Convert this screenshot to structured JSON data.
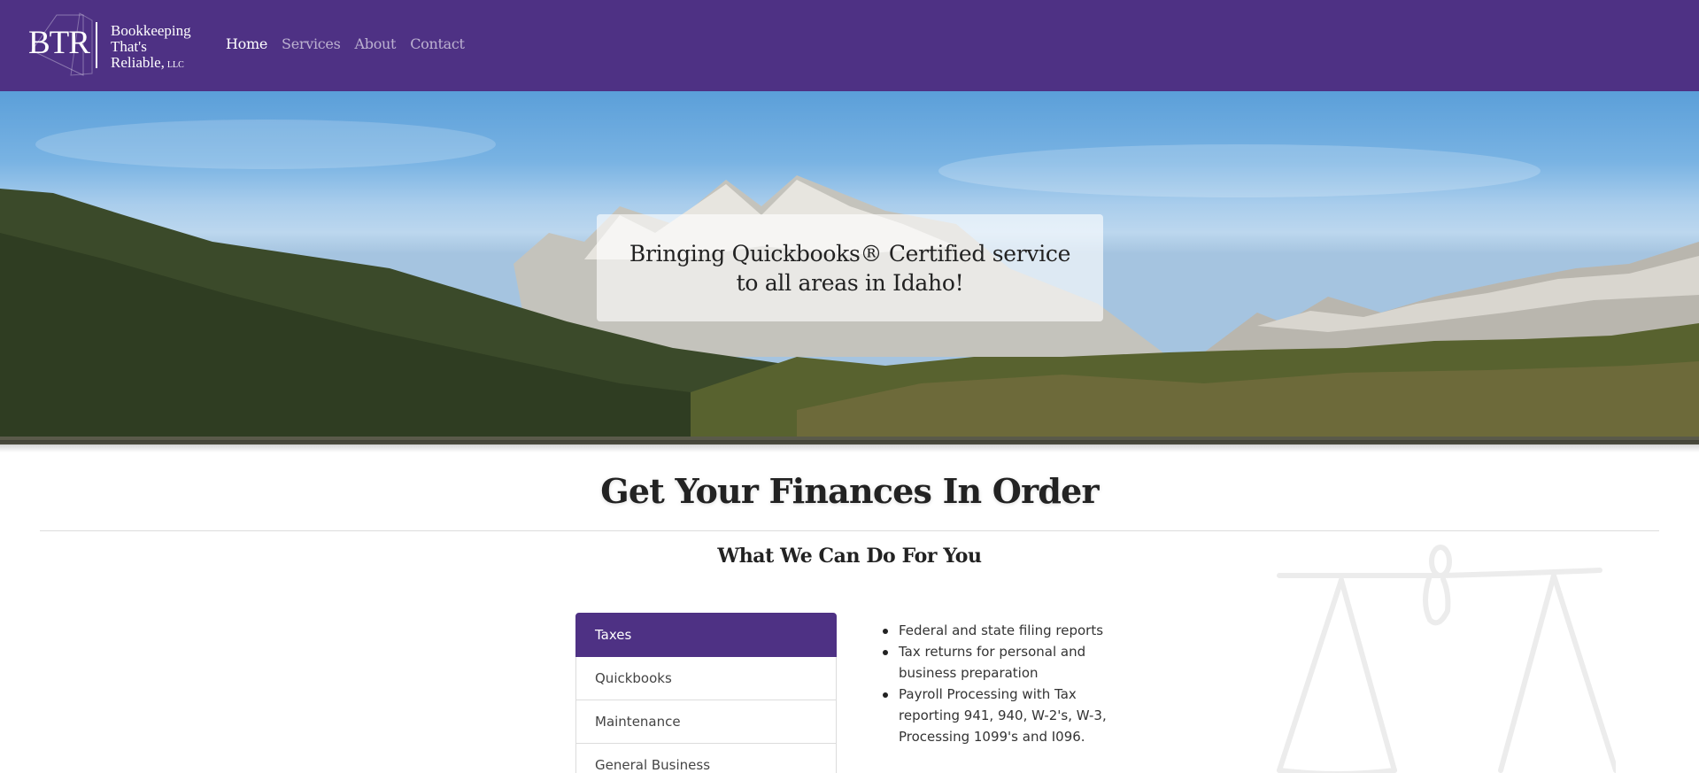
{
  "brand": {
    "initials": "BTR",
    "line1": "Bookkeeping",
    "line2": "That's",
    "line3": "Reliable,",
    "suffix": "LLC"
  },
  "nav": {
    "items": [
      {
        "label": "Home",
        "active": true
      },
      {
        "label": "Services"
      },
      {
        "label": "About"
      },
      {
        "label": "Contact"
      }
    ]
  },
  "hero": {
    "tagline": "Bringing Quickbooks® Certified service to all areas in Idaho!"
  },
  "main": {
    "heading": "Get Your Finances In Order",
    "subheading": "What We Can Do For You"
  },
  "services": {
    "tabs": [
      {
        "label": "Taxes",
        "active": true
      },
      {
        "label": "Quickbooks"
      },
      {
        "label": "Maintenance"
      },
      {
        "label": "General Business"
      }
    ],
    "details": [
      "Federal and state filing reports",
      "Tax returns for personal and business preparation",
      "Payroll Processing with Tax reporting 941, 940, W-2's, W-3, Processing 1099's and I096."
    ]
  },
  "colors": {
    "brand_purple": "#4e3184",
    "nav_text": "#ffffff"
  },
  "icons": [
    "brand-logo-icon",
    "scales-of-justice-icon"
  ]
}
